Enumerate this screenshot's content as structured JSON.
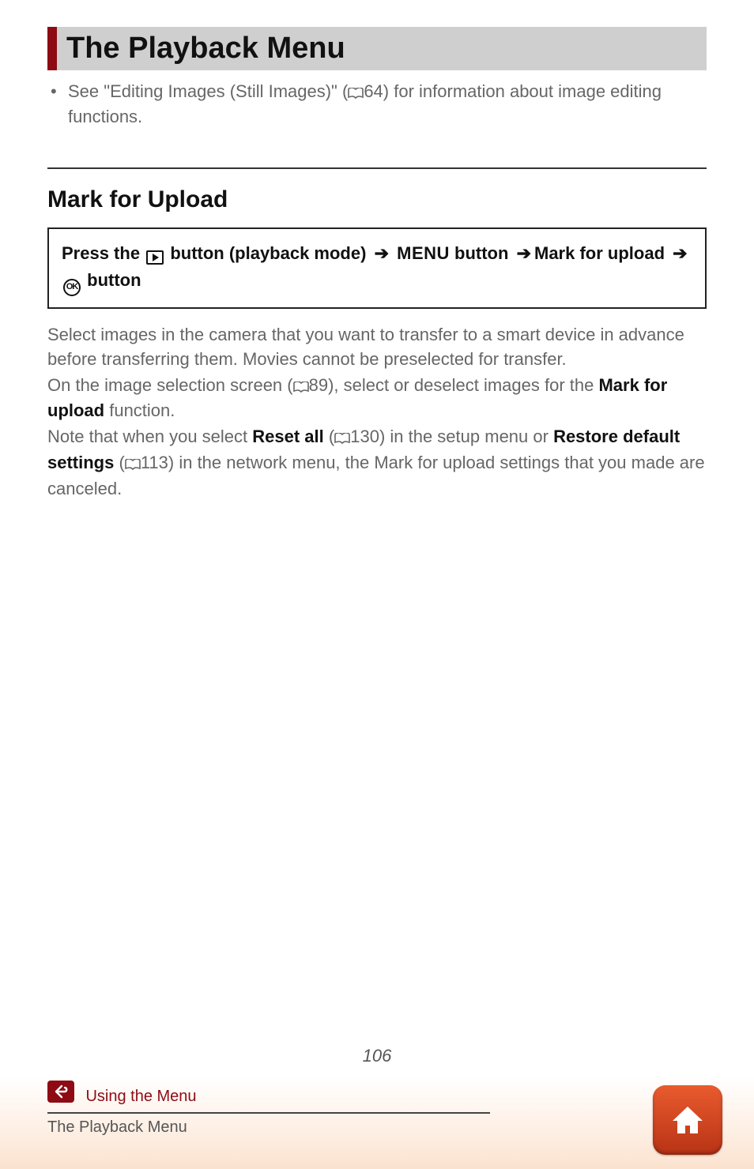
{
  "title": "The Playback Menu",
  "bullet": {
    "prefix": "See \"Editing Images (Still Images)\" (",
    "ref": "64",
    "suffix": ") for information about image editing functions."
  },
  "subhead": "Mark for Upload",
  "steps": {
    "s1": "Press the",
    "s2": "button (playback mode)",
    "menu": "MENU",
    "s3": "button",
    "s4": "Mark for upload",
    "s5": "button",
    "ok": "OK"
  },
  "body": {
    "p1": "Select images in the camera that you want to transfer to a smart device in advance before transferring them. Movies cannot be preselected for transfer.",
    "p2a": "On the image selection screen (",
    "p2ref": "89",
    "p2b": "), select or deselect images for the ",
    "p2bold": "Mark for upload",
    "p2c": " function.",
    "p3a": "Note that when you select ",
    "p3bold1": "Reset all",
    "p3b": " (",
    "p3ref1": "130",
    "p3c": ") in the setup menu or ",
    "p3bold2": "Restore default settings",
    "p3d": " (",
    "p3ref2": "113",
    "p3e": ") in the network menu, the Mark for upload settings that you made are canceled."
  },
  "pagenum": "106",
  "footer": {
    "breadcrumb": "Using the Menu",
    "section": "The Playback Menu"
  }
}
